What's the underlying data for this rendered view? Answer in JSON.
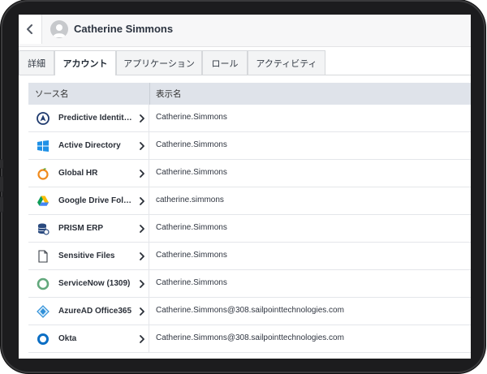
{
  "header": {
    "user_name": "Catherine Simmons"
  },
  "tabs": [
    {
      "label": "詳細"
    },
    {
      "label": "アカウント"
    },
    {
      "label": "アプリケーション"
    },
    {
      "label": "ロール"
    },
    {
      "label": "アクティビティ"
    }
  ],
  "active_tab": "アカウント",
  "table": {
    "columns": [
      {
        "label": "ソース名"
      },
      {
        "label": "表示名"
      }
    ],
    "rows": [
      {
        "source": "Predictive Identity | ...",
        "display": "Catherine.Simmons",
        "icon": "predictive-identity-icon"
      },
      {
        "source": "Active Directory",
        "display": "Catherine.Simmons",
        "icon": "windows-icon"
      },
      {
        "source": "Global HR",
        "display": "Catherine.Simmons",
        "icon": "global-hr-icon"
      },
      {
        "source": "Google Drive Folder...",
        "display": "catherine.simmons",
        "icon": "google-drive-icon"
      },
      {
        "source": "PRISM ERP",
        "display": "Catherine.Simmons",
        "icon": "database-icon"
      },
      {
        "source": "Sensitive Files",
        "display": "Catherine.Simmons",
        "icon": "file-icon"
      },
      {
        "source": "ServiceNow (1309)",
        "display": "Catherine.Simmons",
        "icon": "servicenow-icon"
      },
      {
        "source": "AzureAD Office365",
        "display": "Catherine.Simmons@308.sailpointtechnologies.com",
        "icon": "azure-icon"
      },
      {
        "source": "Okta",
        "display": "Catherine.Simmons@308.sailpointtechnologies.com",
        "icon": "okta-icon"
      }
    ]
  },
  "colors": {
    "header_bg": "#dfe3ea",
    "device_frame": "#1c1c1e",
    "text_dark": "#2a2f38"
  }
}
